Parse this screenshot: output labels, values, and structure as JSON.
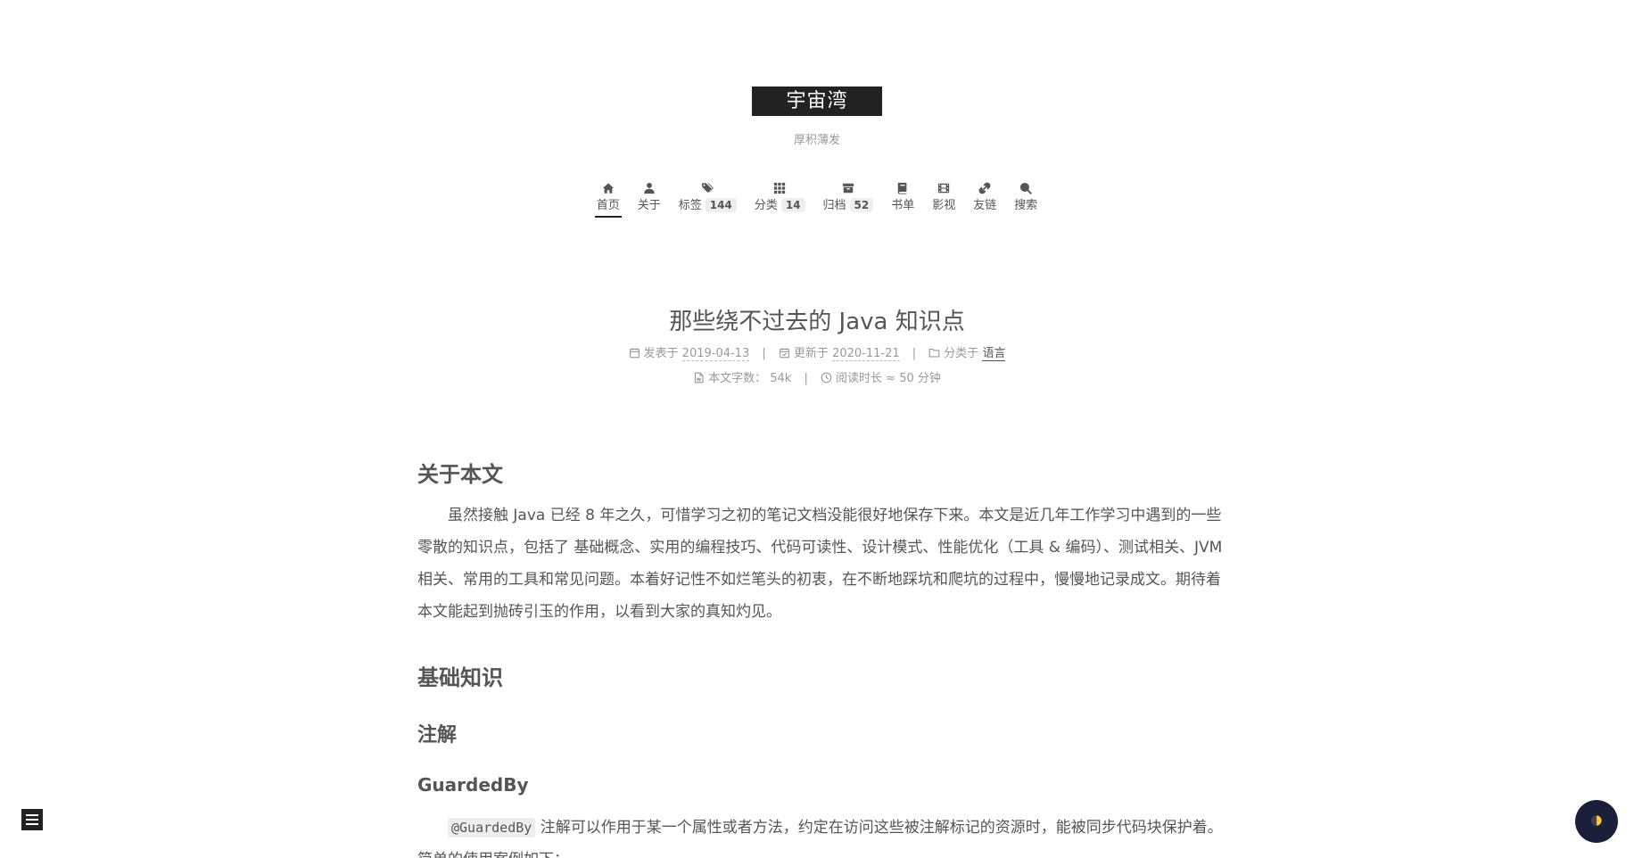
{
  "site": {
    "title": "宇宙湾",
    "subtitle": "厚积薄发"
  },
  "nav": [
    {
      "label": "首页",
      "icon": "home-icon",
      "active": true
    },
    {
      "label": "关于",
      "icon": "user-icon"
    },
    {
      "label": "标签",
      "badge": "144",
      "icon": "tags-icon"
    },
    {
      "label": "分类",
      "badge": "14",
      "icon": "grid-icon"
    },
    {
      "label": "归档",
      "badge": "52",
      "icon": "archive-icon"
    },
    {
      "label": "书单",
      "icon": "book-icon"
    },
    {
      "label": "影视",
      "icon": "film-icon"
    },
    {
      "label": "友链",
      "icon": "link-icon"
    },
    {
      "label": "搜索",
      "icon": "search-icon"
    }
  ],
  "post": {
    "title": "那些绕不过去的 Java 知识点",
    "meta": {
      "published_label": "发表于",
      "published_value": "2019-04-13",
      "updated_label": "更新于",
      "updated_value": "2020-11-21",
      "category_label": "分类于",
      "category_value": "语言",
      "wordcount_label": "本文字数：",
      "wordcount_value": "54k",
      "readtime_label": "阅读时长 ≈",
      "readtime_value": "50 分钟",
      "separator": "|"
    },
    "sections": {
      "about_heading": "关于本文",
      "about_para": "虽然接触 Java 已经 8 年之久，可惜学习之初的笔记文档没能很好地保存下来。本文是近几年工作学习中遇到的一些零散的知识点，包括了 基础概念、实用的编程技巧、代码可读性、设计模式、性能优化（工具 & 编码）、测试相关、JVM 相关、常用的工具和常见问题。本着好记性不如烂笔头的初衷，在不断地踩坑和爬坑的过程中，慢慢地记录成文。期待着本文能起到抛砖引玉的作用，以看到大家的真知灼见。",
      "basics_heading": "基础知识",
      "annotation_heading": "注解",
      "guardedby_heading": "GuardedBy",
      "guardedby_code": "@GuardedBy",
      "guardedby_text": " 注解可以作用于某一个属性或者方法，约定在访问这些被注解标记的资源时，能被同步代码块保护着。简单的使用案例如下："
    }
  },
  "colors": {
    "brand_bg": "#222222",
    "text": "#555555",
    "muted": "#999999",
    "darkmode_bg": "#1c1f3a"
  }
}
